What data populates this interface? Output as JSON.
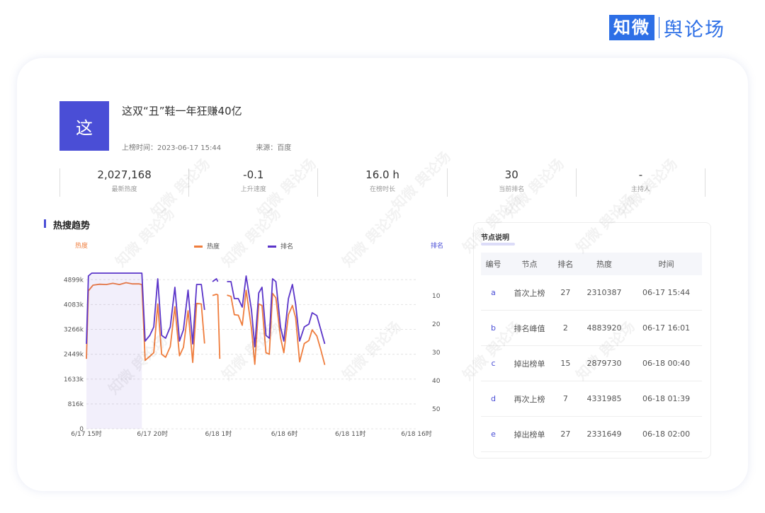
{
  "logo": {
    "brand": "知微",
    "product": "舆论场"
  },
  "topic": {
    "avatar_char": "这",
    "title": "这双“丑”鞋一年狂赚40亿",
    "list_time": "上榜时间：2023-06-17 15:44",
    "source": "来源：百度"
  },
  "stats": [
    {
      "value": "2,027,168",
      "label": "最新热度"
    },
    {
      "value": "-0.1",
      "label": "上升速度"
    },
    {
      "value": "16.0 h",
      "label": "在榜时长"
    },
    {
      "value": "30",
      "label": "当前排名"
    },
    {
      "value": "-",
      "label": "主持人"
    }
  ],
  "section_title": "热搜趋势",
  "table": {
    "title": "节点说明",
    "headers": [
      "编号",
      "节点",
      "排名",
      "热度",
      "时间"
    ],
    "rows": [
      [
        "a",
        "首次上榜",
        "27",
        "2310387",
        "06-17 15:44"
      ],
      [
        "b",
        "排名峰值",
        "2",
        "4883920",
        "06-17 16:01"
      ],
      [
        "c",
        "掉出榜单",
        "15",
        "2879730",
        "06-18 00:40"
      ],
      [
        "d",
        "再次上榜",
        "7",
        "4331985",
        "06-18 01:39"
      ],
      [
        "e",
        "掉出榜单",
        "27",
        "2331649",
        "06-18 02:00"
      ]
    ]
  },
  "watermark": "知微 舆论场",
  "chart_data": {
    "type": "line",
    "left_axis_label": "热度",
    "right_axis_label": "排名",
    "x_ticks": [
      "6/17 15时",
      "6/17 20时",
      "6/18 1时",
      "6/18 6时",
      "6/18 11时",
      "6/18 16时"
    ],
    "y_ticks": [
      "0",
      "816k",
      "1633k",
      "2449k",
      "3266k",
      "4083k",
      "4899k"
    ],
    "y_right_ticks": [
      "10",
      "20",
      "30",
      "40",
      "50"
    ],
    "ylim": [
      0,
      5300000
    ],
    "y2lim": [
      0,
      57
    ],
    "xlim": [
      0,
      25
    ],
    "legend_position": "top-center",
    "grid": true,
    "colors": {
      "heat": "#ef7d3d",
      "rank": "#5b35c9"
    },
    "series": [
      {
        "name": "热度",
        "axis": "left",
        "values": [
          [
            0.0,
            2300000
          ],
          [
            0.15,
            4530000
          ],
          [
            0.5,
            4720000
          ],
          [
            1.0,
            4750000
          ],
          [
            1.5,
            4740000
          ],
          [
            2.0,
            4780000
          ],
          [
            2.5,
            4740000
          ],
          [
            3.0,
            4800000
          ],
          [
            3.5,
            4760000
          ],
          [
            4.0,
            4760000
          ],
          [
            4.2,
            4740000
          ],
          [
            4.45,
            2250000
          ],
          [
            4.8,
            2380000
          ],
          [
            5.1,
            2500000
          ],
          [
            5.4,
            4100000
          ],
          [
            5.7,
            2450000
          ],
          [
            6.0,
            2350000
          ],
          [
            6.35,
            2700000
          ],
          [
            6.7,
            4010000
          ],
          [
            7.05,
            2400000
          ],
          [
            7.35,
            2680000
          ],
          [
            7.7,
            3880000
          ],
          [
            8.05,
            2180000
          ],
          [
            8.35,
            4120000
          ],
          [
            8.7,
            4100000
          ],
          [
            8.95,
            2800000
          ],
          [
            null,
            null
          ],
          [
            9.55,
            4380000
          ],
          [
            9.85,
            4420000
          ],
          [
            9.95,
            4400000
          ],
          [
            10.1,
            2300000
          ],
          [
            null,
            null
          ],
          [
            10.65,
            4390000
          ],
          [
            10.95,
            4350000
          ],
          [
            11.2,
            3750000
          ],
          [
            11.5,
            3730000
          ],
          [
            11.8,
            3400000
          ],
          [
            12.1,
            4550000
          ],
          [
            12.5,
            3300000
          ],
          [
            12.75,
            2120000
          ],
          [
            13.05,
            4100000
          ],
          [
            13.3,
            4050000
          ],
          [
            13.6,
            2500000
          ],
          [
            13.85,
            2450000
          ],
          [
            14.1,
            4450000
          ],
          [
            14.35,
            4300000
          ],
          [
            14.7,
            3000000
          ],
          [
            14.95,
            2500000
          ],
          [
            15.3,
            3750000
          ],
          [
            15.6,
            4050000
          ],
          [
            15.85,
            3650000
          ],
          [
            16.15,
            2200000
          ],
          [
            16.5,
            2800000
          ],
          [
            16.85,
            2900000
          ],
          [
            17.1,
            3250000
          ],
          [
            17.45,
            3050000
          ],
          [
            17.75,
            2600000
          ],
          [
            18.05,
            2100000
          ]
        ]
      },
      {
        "name": "排名",
        "axis": "right",
        "values": [
          [
            0.0,
            27
          ],
          [
            0.15,
            3
          ],
          [
            0.4,
            2
          ],
          [
            1.0,
            2
          ],
          [
            2.0,
            2
          ],
          [
            3.0,
            2
          ],
          [
            4.0,
            2
          ],
          [
            4.2,
            2
          ],
          [
            4.45,
            26
          ],
          [
            4.8,
            24
          ],
          [
            5.1,
            21
          ],
          [
            5.4,
            4
          ],
          [
            5.7,
            24
          ],
          [
            6.0,
            25
          ],
          [
            6.35,
            21
          ],
          [
            6.7,
            7
          ],
          [
            7.05,
            26
          ],
          [
            7.35,
            22
          ],
          [
            7.7,
            8
          ],
          [
            8.05,
            27
          ],
          [
            8.35,
            6
          ],
          [
            8.7,
            6
          ],
          [
            8.95,
            15
          ],
          [
            null,
            null
          ],
          [
            9.55,
            5
          ],
          [
            9.85,
            4
          ],
          [
            9.95,
            5
          ],
          [
            null,
            null
          ],
          [
            10.65,
            5
          ],
          [
            10.95,
            5
          ],
          [
            11.2,
            11
          ],
          [
            11.5,
            11
          ],
          [
            11.8,
            14
          ],
          [
            12.1,
            3
          ],
          [
            12.5,
            15
          ],
          [
            12.75,
            28
          ],
          [
            13.05,
            9
          ],
          [
            13.3,
            7
          ],
          [
            13.6,
            24
          ],
          [
            13.85,
            25
          ],
          [
            14.1,
            4
          ],
          [
            14.35,
            5
          ],
          [
            14.7,
            21
          ],
          [
            14.95,
            26
          ],
          [
            15.3,
            11
          ],
          [
            15.6,
            6
          ],
          [
            15.85,
            13
          ],
          [
            16.15,
            26
          ],
          [
            16.5,
            21
          ],
          [
            16.85,
            20
          ],
          [
            17.1,
            16
          ],
          [
            17.45,
            17
          ],
          [
            17.75,
            22
          ],
          [
            18.05,
            27
          ]
        ]
      }
    ]
  }
}
